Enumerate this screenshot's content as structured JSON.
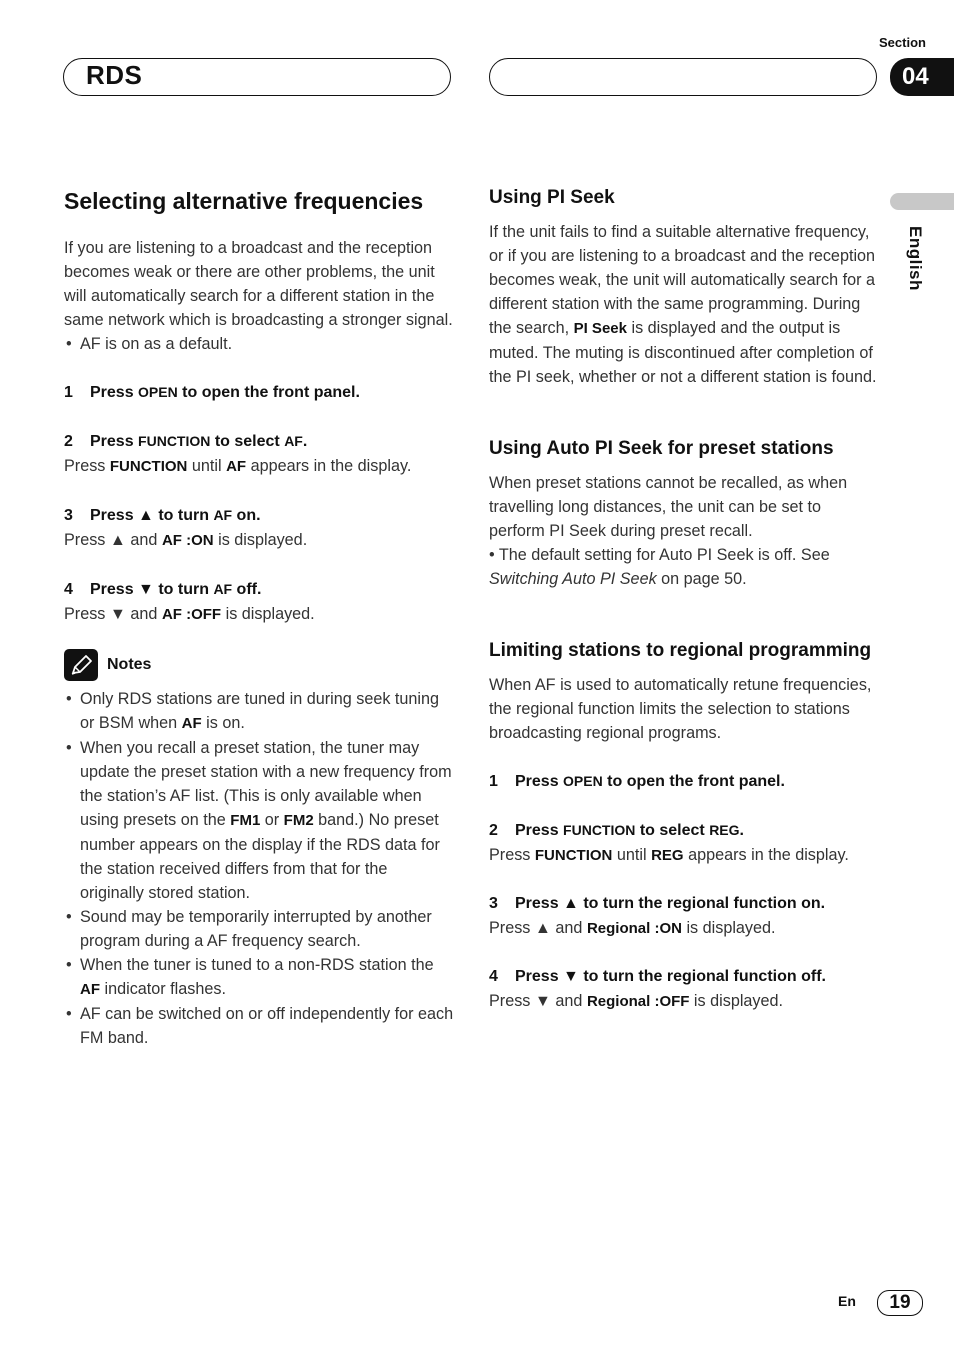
{
  "header": {
    "section_label": "Section",
    "section_number": "04",
    "chapter_title": "RDS",
    "right_pill_text": ""
  },
  "side_tab": {
    "language": "English"
  },
  "left": {
    "title": "Selecting alternative frequencies",
    "intro": "If you are listening to a broadcast and the reception becomes weak or there are other problems, the unit will automatically search for a different station in the same network which is broadcasting a stronger signal.",
    "intro_bullet": "AF is on as a default.",
    "steps": [
      {
        "num": "1",
        "pre": "Press ",
        "key": "OPEN",
        "post": " to open the front panel."
      },
      {
        "num": "2",
        "pre": "Press ",
        "key": "FUNCTION",
        "post": " to select ",
        "key2": "AF",
        "post2": ".",
        "desc": {
          "pre": "Press ",
          "b1": "FUNCTION",
          "mid": " until ",
          "b2": "AF",
          "post": " appears in the display."
        }
      },
      {
        "num": "3",
        "pre": "Press ",
        "symbol": "▲",
        "post": " to turn ",
        "key": "AF",
        "post2": " on.",
        "desc": {
          "pre": "Press ",
          "symbol": "▲",
          "mid": " and ",
          "b1": "AF :ON",
          "post": " is displayed."
        }
      },
      {
        "num": "4",
        "pre": "Press ",
        "symbol": "▼",
        "post": " to turn ",
        "key": "AF",
        "post2": " off.",
        "desc": {
          "pre": "Press ",
          "symbol": "▼",
          "mid": " and ",
          "b1": "AF :OFF",
          "post": " is displayed."
        }
      }
    ],
    "notes": {
      "title": "Notes",
      "icon": "pencil-note-icon",
      "items": [
        {
          "a": "Only RDS stations are tuned in during seek tuning or BSM when ",
          "b": "AF",
          "c": " is on."
        },
        {
          "a": "When you recall a preset station, the tuner may update the preset station with a new frequency from the station’s AF list. (This is only available when using presets on the ",
          "b": "FM1",
          "c": " or ",
          "d": "FM2",
          "e": " band.) No preset number appears on the display if the RDS data for the station received differs from that for the originally stored station."
        },
        {
          "a": "Sound may be temporarily interrupted by another program during a AF frequency search."
        },
        {
          "a": "When the tuner is tuned to a non-RDS station the ",
          "b": "AF",
          "c": " indicator flashes."
        },
        {
          "a": "AF can be switched on or off independently for each FM band."
        }
      ]
    }
  },
  "right": {
    "pi_seek": {
      "title": "Using PI Seek",
      "body_a": "If the unit fails to find a suitable alternative frequency, or if you are listening to a broadcast and the reception becomes weak, the unit will automatically search for a different station with the same programming. During the search, ",
      "body_b": "PI Seek",
      "body_c": " is displayed and the output is muted. The muting is discontinued after completion of the PI seek, whether or not a different station is found."
    },
    "auto_pi": {
      "title": "Using Auto PI Seek for preset stations",
      "body": "When preset stations cannot be recalled, as when travelling long distances, the unit can be set to perform PI Seek during preset recall.",
      "bullet_a": "The default setting for Auto PI Seek is off. See ",
      "bullet_link": "Switching Auto PI Seek",
      "bullet_b": " on page 50."
    },
    "regional": {
      "title": "Limiting stations to regional programming",
      "body": "When AF is used to automatically retune frequencies, the regional function limits the selection to stations broadcasting regional programs.",
      "steps": [
        {
          "num": "1",
          "pre": "Press ",
          "key": "OPEN",
          "post": " to open the front panel."
        },
        {
          "num": "2",
          "pre": "Press ",
          "key": "FUNCTION",
          "post": " to select ",
          "key2": "REG",
          "post2": ".",
          "desc": {
            "pre": "Press ",
            "b1": "FUNCTION",
            "mid": " until ",
            "b2": "REG",
            "post": " appears in the display."
          }
        },
        {
          "num": "3",
          "pre": "Press ",
          "symbol": "▲",
          "post": " to turn the regional function on.",
          "desc": {
            "pre": "Press ",
            "symbol": "▲",
            "mid": " and ",
            "b1": "Regional :ON",
            "post": " is displayed."
          }
        },
        {
          "num": "4",
          "pre": "Press ",
          "symbol": "▼",
          "post": " to turn the regional function off.",
          "desc": {
            "pre": "Press ",
            "symbol": "▼",
            "mid": " and ",
            "b1": "Regional :OFF",
            "post": " is displayed."
          }
        }
      ]
    }
  },
  "footer": {
    "lang_code": "En",
    "page_number": "19"
  }
}
